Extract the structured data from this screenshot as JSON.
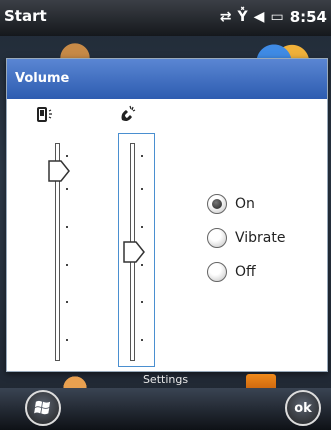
{
  "statusbar": {
    "title": "Start",
    "time": "8:54",
    "icons": [
      "connection-arrows-icon",
      "no-signal-icon",
      "speaker-icon",
      "battery-icon"
    ]
  },
  "dialog": {
    "title": "Volume",
    "title_color": "#2d5cb0",
    "system_volume": {
      "icon": "device-speaker-icon",
      "level": 0.87
    },
    "call_volume": {
      "icon": "phone-handset-icon",
      "level": 0.5
    },
    "ring_mode": {
      "options": [
        "On",
        "Vibrate",
        "Off"
      ],
      "selected": "On"
    }
  },
  "bottom": {
    "settings_label": "Settings",
    "ok_label": "ok",
    "start_icon": "windows-flag-icon"
  }
}
